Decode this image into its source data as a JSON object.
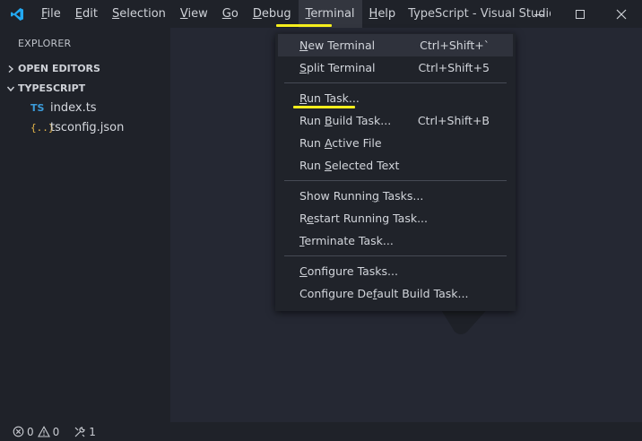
{
  "menubar": {
    "items": [
      {
        "pre": "",
        "u": "F",
        "post": "ile"
      },
      {
        "pre": "",
        "u": "E",
        "post": "dit"
      },
      {
        "pre": "",
        "u": "S",
        "post": "election"
      },
      {
        "pre": "",
        "u": "V",
        "post": "iew"
      },
      {
        "pre": "",
        "u": "G",
        "post": "o"
      },
      {
        "pre": "",
        "u": "D",
        "post": "ebug"
      },
      {
        "pre": "",
        "u": "T",
        "post": "erminal"
      },
      {
        "pre": "",
        "u": "H",
        "post": "elp"
      }
    ],
    "window_title": "TypeScript - Visual Studio C..."
  },
  "sidebar": {
    "title": "EXPLORER",
    "open_editors": "OPEN EDITORS",
    "folder": "TYPESCRIPT",
    "files": [
      {
        "icon": "TS",
        "name": "index.ts"
      },
      {
        "icon": "{..}",
        "name": "tsconfig.json"
      }
    ]
  },
  "terminal_menu": {
    "groups": [
      [
        {
          "pre": "",
          "u": "N",
          "post": "ew Terminal",
          "key": "Ctrl+Shift+`"
        },
        {
          "pre": "",
          "u": "S",
          "post": "plit Terminal",
          "key": "Ctrl+Shift+5"
        }
      ],
      [
        {
          "pre": "",
          "u": "R",
          "post": "un Task...",
          "key": ""
        },
        {
          "pre": "Run ",
          "u": "B",
          "post": "uild Task...",
          "key": "Ctrl+Shift+B"
        },
        {
          "pre": "Run ",
          "u": "A",
          "post": "ctive File",
          "key": ""
        },
        {
          "pre": "Run ",
          "u": "S",
          "post": "elected Text",
          "key": ""
        }
      ],
      [
        {
          "pre": "Show Runnin",
          "u": "g",
          "post": " Tasks...",
          "key": ""
        },
        {
          "pre": "R",
          "u": "e",
          "post": "start Running Task...",
          "key": ""
        },
        {
          "pre": "",
          "u": "T",
          "post": "erminate Task...",
          "key": ""
        }
      ],
      [
        {
          "pre": "",
          "u": "C",
          "post": "onfigure Tasks...",
          "key": ""
        },
        {
          "pre": "Configure De",
          "u": "f",
          "post": "ault Build Task...",
          "key": ""
        }
      ]
    ]
  },
  "statusbar": {
    "errors": "0",
    "warnings": "0",
    "ports": "1"
  },
  "colors": {
    "highlight": "#f5ee1c",
    "accent_logo": "#23a9f2"
  }
}
